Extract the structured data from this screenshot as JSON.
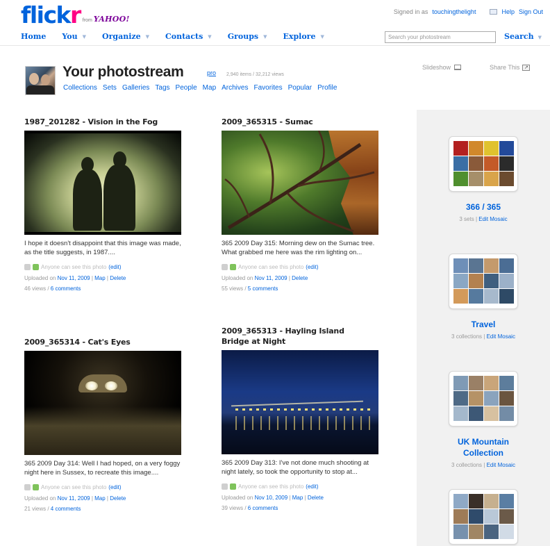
{
  "header": {
    "logo_flick": "flick",
    "logo_r": "r",
    "logo_from": "from",
    "logo_yahoo": "YAHOO!",
    "signed_in_label": "Signed in as",
    "username": "touchingthelight",
    "help": "Help",
    "sign_out": "Sign Out",
    "nav": [
      "Home",
      "You",
      "Organize",
      "Contacts",
      "Groups",
      "Explore"
    ],
    "search_placeholder": "Search your photostream",
    "search_button": "Search"
  },
  "photostream": {
    "title": "Your photostream",
    "badge": "pro",
    "stats": "2,940 items / 32,212 views",
    "subnav": [
      "Collections",
      "Sets",
      "Galleries",
      "Tags",
      "People",
      "Map",
      "Archives",
      "Favorites",
      "Popular",
      "Profile"
    ],
    "slideshow": "Slideshow",
    "share_this": "Share This"
  },
  "photos": [
    {
      "title": "1987_201282 - Vision in the Fog",
      "description": "I hope it doesn't disappoint that this image was made, as the title suggests, in 1987.",
      "ellipsis": "...",
      "privacy": "Anyone can see this photo",
      "edit": "(edit)",
      "uploaded_label": "Uploaded on",
      "uploaded_date": "Nov 11, 2009",
      "map": "Map",
      "delete": "Delete",
      "views": "46 views",
      "comments": "6 comments"
    },
    {
      "title": "2009_365315 - Sumac",
      "description": "365 2009 Day 315: Morning dew on the Sumac tree. What grabbed me here was the rim lighting on",
      "ellipsis": "...",
      "privacy": "Anyone can see this photo",
      "edit": "(edit)",
      "uploaded_label": "Uploaded on",
      "uploaded_date": "Nov 11, 2009",
      "map": "",
      "delete": "Delete",
      "views": "55 views",
      "comments": "5 comments"
    },
    {
      "title": "2009_365314 - Cat's Eyes",
      "description": "365 2009 Day 314: Well I had hoped, on a very foggy night here in Sussex, to recreate this image.",
      "ellipsis": "...",
      "privacy": "Anyone can see this photo",
      "edit": "(edit)",
      "uploaded_label": "Uploaded on",
      "uploaded_date": "Nov 11, 2009",
      "map": "Map",
      "delete": "Delete",
      "views": "21 views",
      "comments": "4 comments"
    },
    {
      "title": "2009_365313 - Hayling Island Bridge at Night",
      "description": "365 2009 Day 313: I've not done much shooting at night lately, so took the opportunity to stop at",
      "ellipsis": "...",
      "privacy": "Anyone can see this photo",
      "edit": "(edit)",
      "uploaded_label": "Uploaded on",
      "uploaded_date": "Nov 10, 2009",
      "map": "Map",
      "delete": "Delete",
      "views": "39 views",
      "comments": "6 comments"
    }
  ],
  "collections": [
    {
      "name": "366 / 365",
      "sub": "3 sets",
      "edit": "Edit Mosaic"
    },
    {
      "name": "Travel",
      "sub": "3 collections",
      "edit": "Edit Mosaic"
    },
    {
      "name": "UK Mountain Collection",
      "sub": "3 collections",
      "edit": "Edit Mosaic"
    }
  ]
}
